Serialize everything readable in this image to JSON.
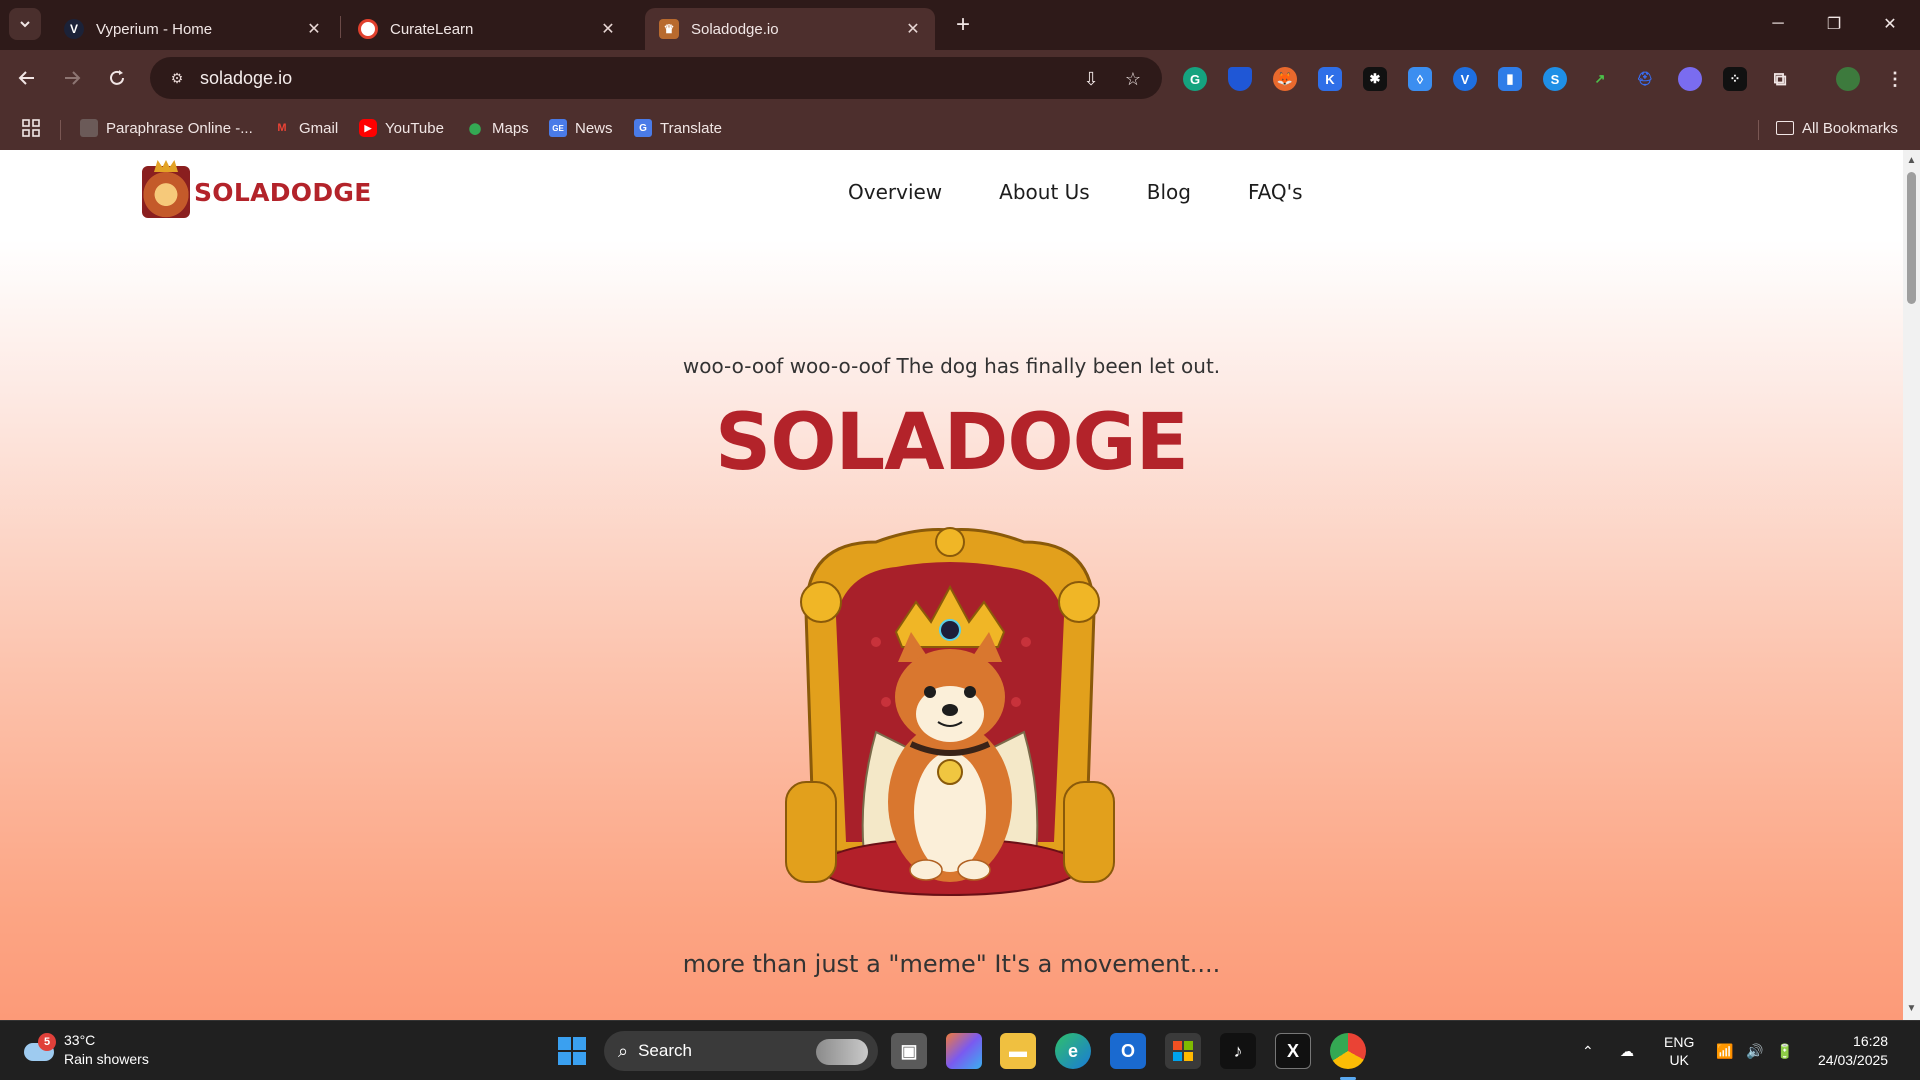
{
  "browser": {
    "tabs": [
      {
        "title": "Vyperium - Home",
        "active": false
      },
      {
        "title": "CurateLearn",
        "active": false
      },
      {
        "title": "Soladodge.io",
        "active": true
      }
    ],
    "address": "soladoge.io",
    "bookmarks": [
      "Paraphrase Online -...",
      "Gmail",
      "YouTube",
      "Maps",
      "News",
      "Translate"
    ],
    "all_bookmarks": "All Bookmarks"
  },
  "site": {
    "logo_text": "SOLADODGE",
    "nav": [
      "Overview",
      "About Us",
      "Blog",
      "FAQ's"
    ],
    "tagline": "woo-o-oof woo-o-oof The dog has finally been let out.",
    "hero_title": "SOLADOGE",
    "subline": "more than just a \"meme\" It's a movement...."
  },
  "taskbar": {
    "weather_temp": "33°C",
    "weather_desc": "Rain showers",
    "weather_badge": "5",
    "search_label": "Search",
    "lang": "ENG",
    "region": "UK",
    "time": "16:28",
    "date": "24/03/2025"
  },
  "colors": {
    "brand_red": "#b3232a",
    "browser_frame": "#4d2f2d"
  }
}
